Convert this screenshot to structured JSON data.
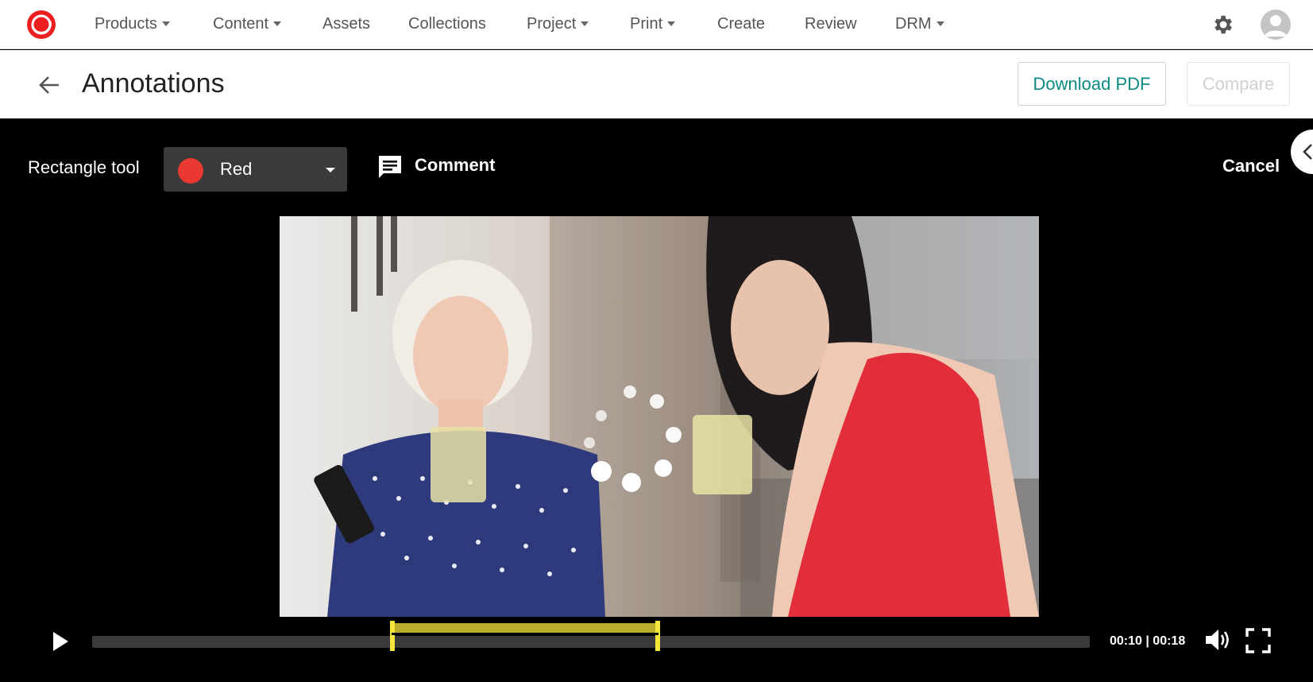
{
  "nav": {
    "logo": "sitecore-logo-icon",
    "items": [
      {
        "label": "Products",
        "dropdown": true
      },
      {
        "label": "Content",
        "dropdown": true
      },
      {
        "label": "Assets",
        "dropdown": false
      },
      {
        "label": "Collections",
        "dropdown": false
      },
      {
        "label": "Project",
        "dropdown": true
      },
      {
        "label": "Print",
        "dropdown": true
      },
      {
        "label": "Create",
        "dropdown": false
      },
      {
        "label": "Review",
        "dropdown": false
      },
      {
        "label": "DRM",
        "dropdown": true
      }
    ],
    "settings_icon": "gear-icon",
    "user_icon": "user-avatar-icon"
  },
  "header": {
    "title": "Annotations",
    "download_label": "Download PDF",
    "compare_label": "Compare"
  },
  "toolbar": {
    "tool_label": "Rectangle tool",
    "color": {
      "label": "Red",
      "value": "#e8382f"
    },
    "comment_label": "Comment",
    "cancel_label": "Cancel"
  },
  "player": {
    "time_current": "00:10",
    "time_total": "00:18",
    "time_text": "00:10 | 00:18",
    "progress": 0.0,
    "loading": true,
    "range_color": "#f5e63c"
  },
  "colors": {
    "accent": "#0a8a82",
    "brand": "#eb1f1f",
    "range": "#f5e63c"
  }
}
